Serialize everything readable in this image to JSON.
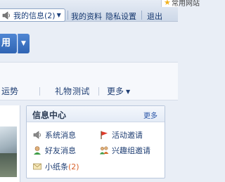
{
  "topbar": {
    "messages_label": "我的信息(2)",
    "links": [
      "我的资料",
      "隐私设置",
      "退出"
    ],
    "cut_text": "常用网站"
  },
  "app_tab": {
    "label": "用"
  },
  "nav": {
    "items": [
      "运势",
      "礼物",
      "测试"
    ],
    "more_label": "更多"
  },
  "info_center": {
    "title": "信息中心",
    "more_label": "更多",
    "items": [
      {
        "label": "系统消息",
        "icon": "speaker-icon"
      },
      {
        "label": "活动邀请",
        "icon": "flag-icon"
      },
      {
        "label": "好友消息",
        "icon": "person-icon"
      },
      {
        "label": "兴趣组邀请",
        "icon": "group-icon"
      },
      {
        "label": "小纸条",
        "count": "(2)",
        "icon": "envelope-icon"
      }
    ]
  },
  "colors": {
    "link_blue": "#1f3e73",
    "tab_blue": "#3a72c4",
    "count_orange": "#d9622b",
    "star_yellow": "#f3b21d"
  }
}
